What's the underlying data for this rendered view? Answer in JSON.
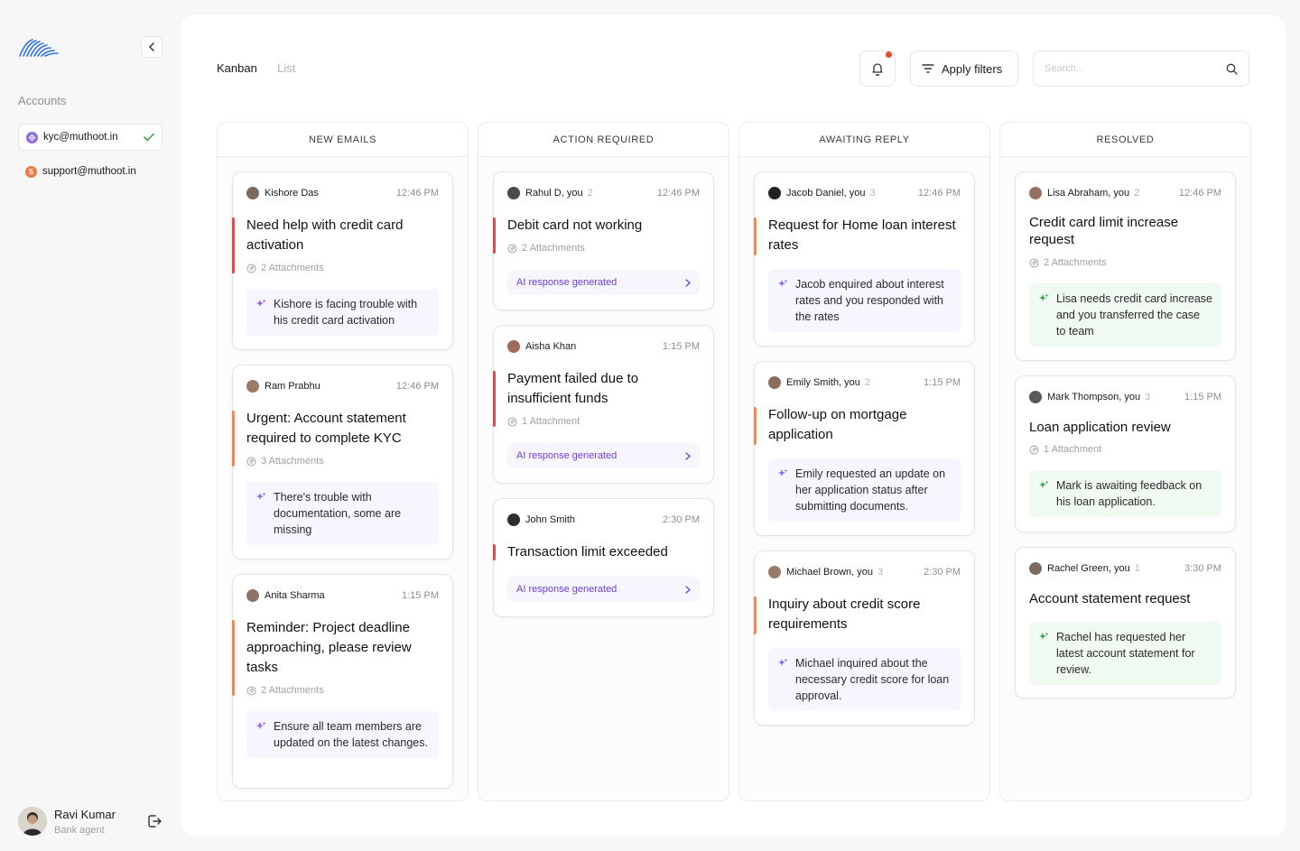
{
  "sidebar": {
    "accounts_label": "Accounts",
    "accounts": [
      {
        "email": "kyc@muthoot.in",
        "icon": "kyc-account-icon",
        "color": "#8b6be8",
        "active": true
      },
      {
        "email": "support@muthoot.in",
        "icon": "support-account-icon",
        "color": "#f07a43",
        "initial": "S",
        "active": false
      }
    ],
    "user": {
      "name": "Ravi Kumar",
      "role": "Bank agent"
    }
  },
  "header": {
    "tabs": [
      {
        "label": "Kanban",
        "active": true
      },
      {
        "label": "List",
        "active": false
      }
    ],
    "filter_label": "Apply filters",
    "search_placeholder": "Search..."
  },
  "colors": {
    "accent": "#6d3fd6",
    "red": "#e5484d",
    "orange": "#f4874a",
    "green_spark": "#3aa15a",
    "purple_spark": "#8b5cf6"
  },
  "columns": [
    {
      "title": "NEW EMAILS",
      "cards": [
        {
          "sender": "Kishore Das",
          "count": "",
          "time": "12:46 PM",
          "title": "Need help with credit card activation",
          "attachments": "2 Attachments",
          "summary": "Kishore is facing trouble with his credit card activation",
          "priority": "red"
        },
        {
          "sender": "Ram Prabhu",
          "count": "",
          "time": "12:46 PM",
          "title": "Urgent: Account statement required to complete KYC",
          "attachments": "3 Attachments",
          "summary": "There's trouble with documentation, some are missing",
          "priority": "orange"
        },
        {
          "sender": "Anita Sharma",
          "count": "",
          "time": "1:15 PM",
          "title": "Reminder: Project deadline approaching, please review tasks",
          "attachments": "2 Attachments",
          "summary": "Ensure all team members are updated on the latest changes.",
          "priority": "orange"
        }
      ]
    },
    {
      "title": "ACTION REQUIRED",
      "cards": [
        {
          "sender": "Rahul D, you",
          "count": "2",
          "time": "12:46 PM",
          "title": "Debit card not working",
          "attachments": "2 Attachments",
          "ai_label": "AI response generated",
          "priority": "red"
        },
        {
          "sender": "Aisha Khan",
          "count": "",
          "time": "1:15 PM",
          "title": "Payment failed due to insufficient funds",
          "attachments": "1 Attachment",
          "ai_label": "AI response generated",
          "priority": "red"
        },
        {
          "sender": "John Smith",
          "count": "",
          "time": "2:30 PM",
          "title": "Transaction limit exceeded",
          "ai_label": "AI response generated",
          "priority": "red"
        }
      ]
    },
    {
      "title": "AWAITING REPLY",
      "cards": [
        {
          "sender": "Jacob Daniel, you",
          "count": "3",
          "time": "12:46 PM",
          "title": "Request for Home loan interest rates",
          "summary": "Jacob enquired about interest rates and you responded with the rates",
          "priority": "orange"
        },
        {
          "sender": "Emily Smith, you",
          "count": "2",
          "time": "1:15 PM",
          "title": "Follow-up on mortgage application",
          "summary": "Emily requested an update on her application status after submitting documents.",
          "priority": "orange"
        },
        {
          "sender": "Michael Brown, you",
          "count": "3",
          "time": "2:30 PM",
          "title": "Inquiry about credit score requirements",
          "summary": "Michael inquired about the necessary credit score for loan approval.",
          "priority": "orange"
        }
      ]
    },
    {
      "title": "RESOLVED",
      "cards": [
        {
          "sender": "Lisa Abraham, you",
          "count": "2",
          "time": "12:46 PM",
          "title": "Credit card limit increase request",
          "attachments": "2 Attachments",
          "summary": "Lisa needs credit card increase and you transferred the case to team"
        },
        {
          "sender": "Mark Thompson, you",
          "count": "3",
          "time": "1:15 PM",
          "title": "Loan application review",
          "attachments": "1 Attachment",
          "summary": "Mark is awaiting feedback on his loan application."
        },
        {
          "sender": "Rachel Green, you",
          "count": "1",
          "time": "3:30 PM",
          "title": "Account statement request",
          "summary": "Rachel has requested her latest account statement for review."
        }
      ]
    }
  ]
}
